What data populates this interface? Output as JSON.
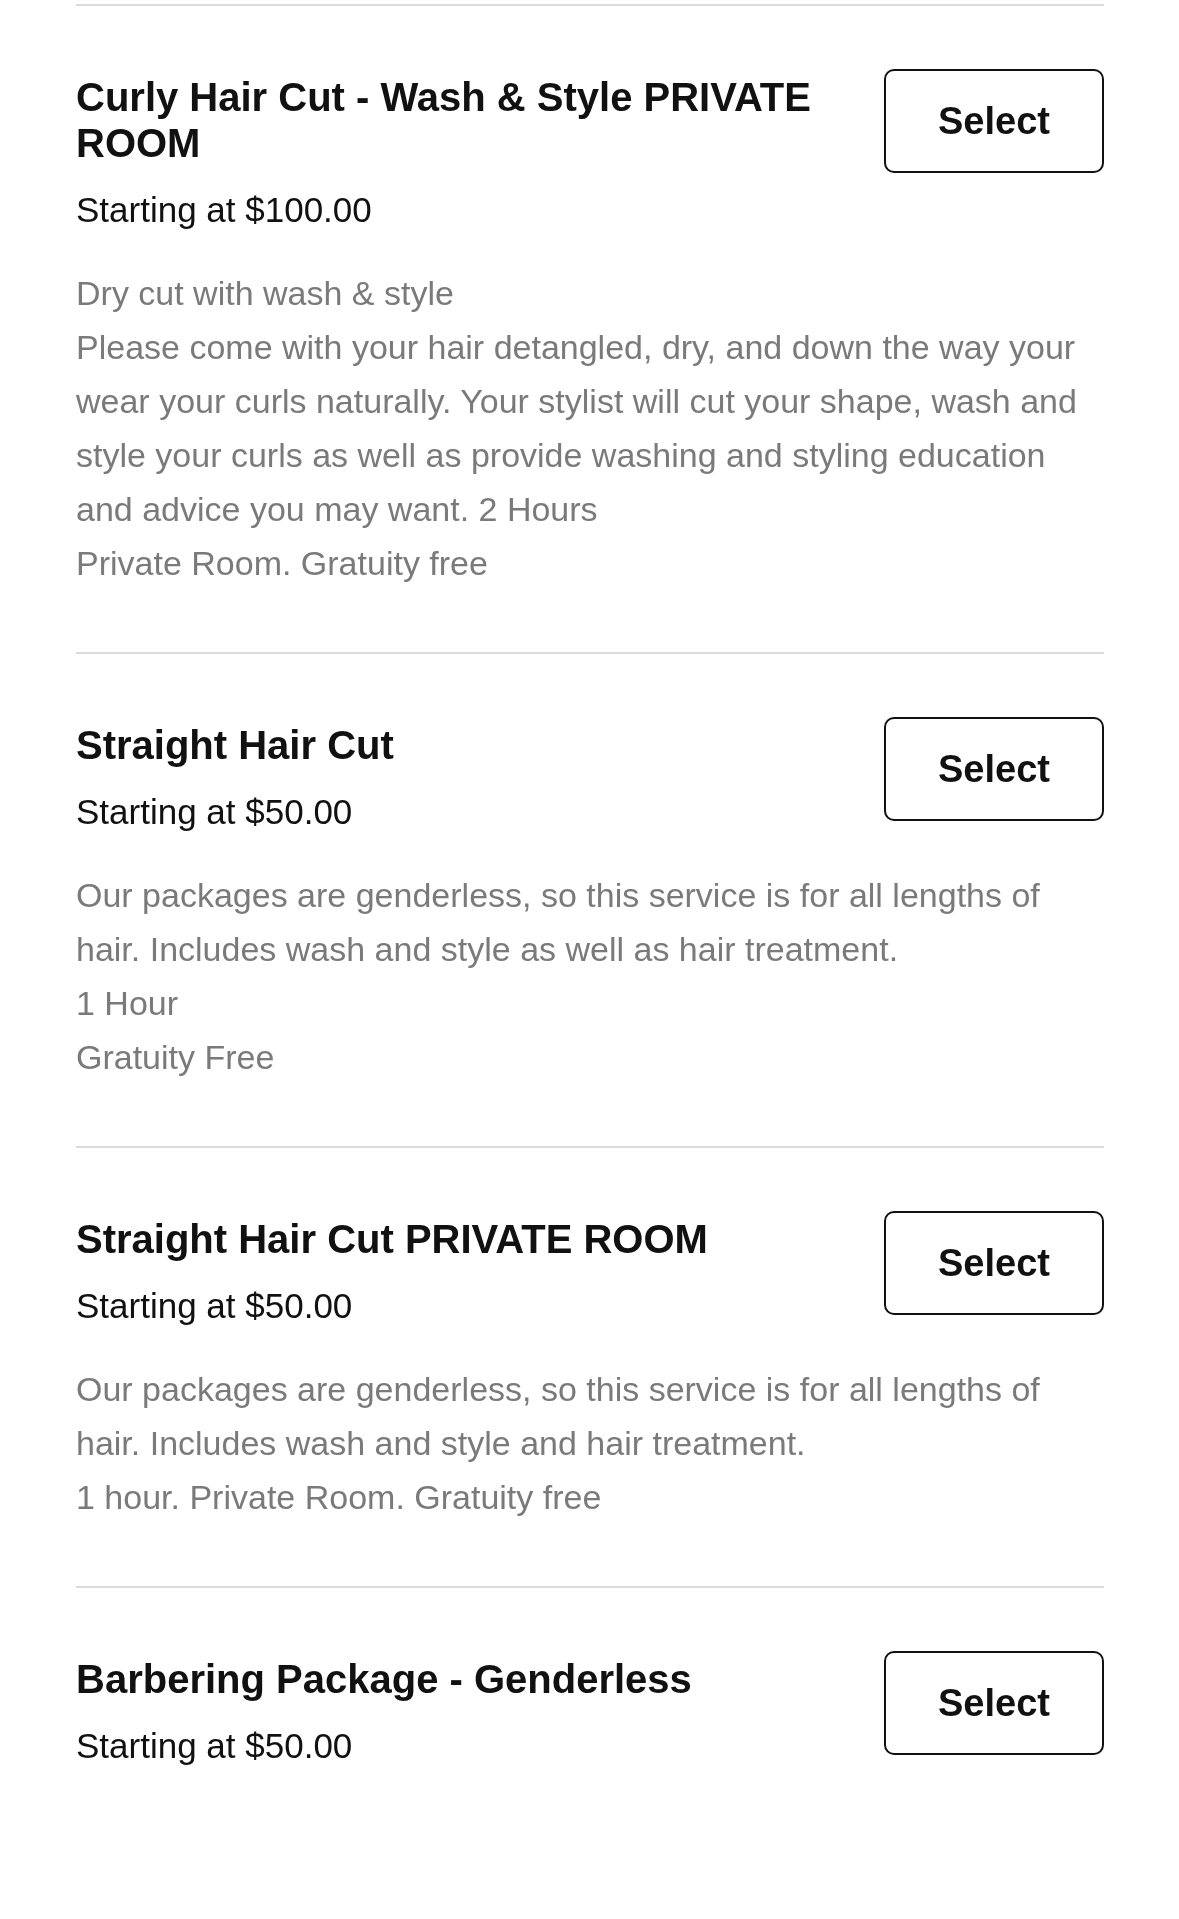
{
  "services": [
    {
      "title": "Curly Hair Cut - Wash & Style PRIVATE ROOM",
      "price": "Starting at $100.00",
      "button": "Select",
      "description": [
        "Dry cut with wash & style",
        "Please come with your hair detangled, dry, and down the way your wear your curls naturally. Your stylist will cut your shape, wash and style your curls as well as provide washing and styling education and advice you may want. 2 Hours",
        "Private Room. Gratuity free"
      ]
    },
    {
      "title": "Straight Hair Cut",
      "price": "Starting at $50.00",
      "button": "Select",
      "description": [
        "Our packages are genderless, so this service is for all lengths of hair. Includes wash and style as well as hair treatment.",
        "1 Hour",
        "Gratuity Free"
      ]
    },
    {
      "title": "Straight Hair Cut PRIVATE ROOM",
      "price": "Starting at $50.00",
      "button": "Select",
      "description": [
        "Our packages are genderless, so this service is for all lengths of hair. Includes wash and style and hair treatment.",
        "1 hour. Private Room. Gratuity free"
      ]
    },
    {
      "title": "Barbering Package - Genderless",
      "price": "Starting at $50.00",
      "button": "Select"
    }
  ]
}
